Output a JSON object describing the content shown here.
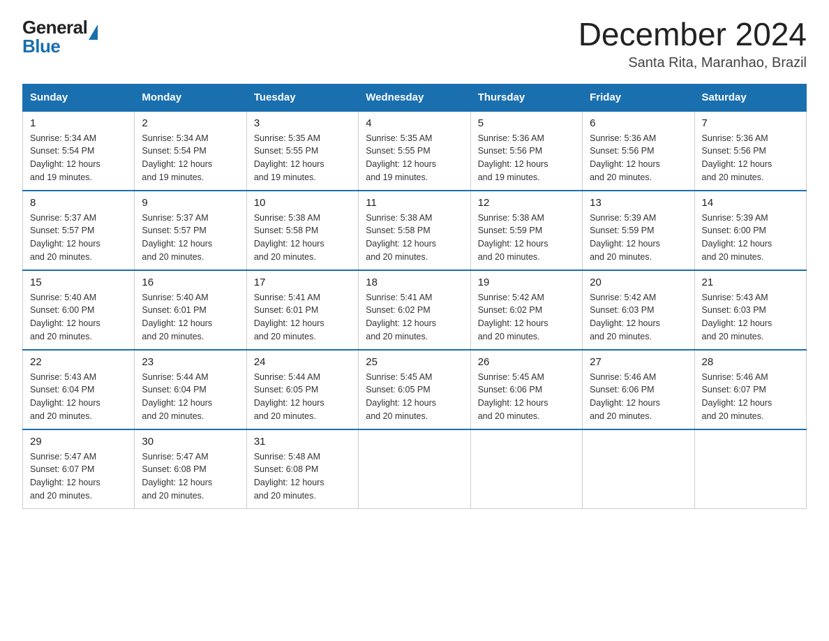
{
  "logo": {
    "text_general": "General",
    "text_blue": "Blue"
  },
  "title": "December 2024",
  "subtitle": "Santa Rita, Maranhao, Brazil",
  "weekdays": [
    "Sunday",
    "Monday",
    "Tuesday",
    "Wednesday",
    "Thursday",
    "Friday",
    "Saturday"
  ],
  "weeks": [
    [
      {
        "day": "1",
        "sunrise": "5:34 AM",
        "sunset": "5:54 PM",
        "daylight": "12 hours and 19 minutes."
      },
      {
        "day": "2",
        "sunrise": "5:34 AM",
        "sunset": "5:54 PM",
        "daylight": "12 hours and 19 minutes."
      },
      {
        "day": "3",
        "sunrise": "5:35 AM",
        "sunset": "5:55 PM",
        "daylight": "12 hours and 19 minutes."
      },
      {
        "day": "4",
        "sunrise": "5:35 AM",
        "sunset": "5:55 PM",
        "daylight": "12 hours and 19 minutes."
      },
      {
        "day": "5",
        "sunrise": "5:36 AM",
        "sunset": "5:56 PM",
        "daylight": "12 hours and 19 minutes."
      },
      {
        "day": "6",
        "sunrise": "5:36 AM",
        "sunset": "5:56 PM",
        "daylight": "12 hours and 20 minutes."
      },
      {
        "day": "7",
        "sunrise": "5:36 AM",
        "sunset": "5:56 PM",
        "daylight": "12 hours and 20 minutes."
      }
    ],
    [
      {
        "day": "8",
        "sunrise": "5:37 AM",
        "sunset": "5:57 PM",
        "daylight": "12 hours and 20 minutes."
      },
      {
        "day": "9",
        "sunrise": "5:37 AM",
        "sunset": "5:57 PM",
        "daylight": "12 hours and 20 minutes."
      },
      {
        "day": "10",
        "sunrise": "5:38 AM",
        "sunset": "5:58 PM",
        "daylight": "12 hours and 20 minutes."
      },
      {
        "day": "11",
        "sunrise": "5:38 AM",
        "sunset": "5:58 PM",
        "daylight": "12 hours and 20 minutes."
      },
      {
        "day": "12",
        "sunrise": "5:38 AM",
        "sunset": "5:59 PM",
        "daylight": "12 hours and 20 minutes."
      },
      {
        "day": "13",
        "sunrise": "5:39 AM",
        "sunset": "5:59 PM",
        "daylight": "12 hours and 20 minutes."
      },
      {
        "day": "14",
        "sunrise": "5:39 AM",
        "sunset": "6:00 PM",
        "daylight": "12 hours and 20 minutes."
      }
    ],
    [
      {
        "day": "15",
        "sunrise": "5:40 AM",
        "sunset": "6:00 PM",
        "daylight": "12 hours and 20 minutes."
      },
      {
        "day": "16",
        "sunrise": "5:40 AM",
        "sunset": "6:01 PM",
        "daylight": "12 hours and 20 minutes."
      },
      {
        "day": "17",
        "sunrise": "5:41 AM",
        "sunset": "6:01 PM",
        "daylight": "12 hours and 20 minutes."
      },
      {
        "day": "18",
        "sunrise": "5:41 AM",
        "sunset": "6:02 PM",
        "daylight": "12 hours and 20 minutes."
      },
      {
        "day": "19",
        "sunrise": "5:42 AM",
        "sunset": "6:02 PM",
        "daylight": "12 hours and 20 minutes."
      },
      {
        "day": "20",
        "sunrise": "5:42 AM",
        "sunset": "6:03 PM",
        "daylight": "12 hours and 20 minutes."
      },
      {
        "day": "21",
        "sunrise": "5:43 AM",
        "sunset": "6:03 PM",
        "daylight": "12 hours and 20 minutes."
      }
    ],
    [
      {
        "day": "22",
        "sunrise": "5:43 AM",
        "sunset": "6:04 PM",
        "daylight": "12 hours and 20 minutes."
      },
      {
        "day": "23",
        "sunrise": "5:44 AM",
        "sunset": "6:04 PM",
        "daylight": "12 hours and 20 minutes."
      },
      {
        "day": "24",
        "sunrise": "5:44 AM",
        "sunset": "6:05 PM",
        "daylight": "12 hours and 20 minutes."
      },
      {
        "day": "25",
        "sunrise": "5:45 AM",
        "sunset": "6:05 PM",
        "daylight": "12 hours and 20 minutes."
      },
      {
        "day": "26",
        "sunrise": "5:45 AM",
        "sunset": "6:06 PM",
        "daylight": "12 hours and 20 minutes."
      },
      {
        "day": "27",
        "sunrise": "5:46 AM",
        "sunset": "6:06 PM",
        "daylight": "12 hours and 20 minutes."
      },
      {
        "day": "28",
        "sunrise": "5:46 AM",
        "sunset": "6:07 PM",
        "daylight": "12 hours and 20 minutes."
      }
    ],
    [
      {
        "day": "29",
        "sunrise": "5:47 AM",
        "sunset": "6:07 PM",
        "daylight": "12 hours and 20 minutes."
      },
      {
        "day": "30",
        "sunrise": "5:47 AM",
        "sunset": "6:08 PM",
        "daylight": "12 hours and 20 minutes."
      },
      {
        "day": "31",
        "sunrise": "5:48 AM",
        "sunset": "6:08 PM",
        "daylight": "12 hours and 20 minutes."
      },
      null,
      null,
      null,
      null
    ]
  ],
  "labels": {
    "sunrise": "Sunrise:",
    "sunset": "Sunset:",
    "daylight": "Daylight:"
  }
}
